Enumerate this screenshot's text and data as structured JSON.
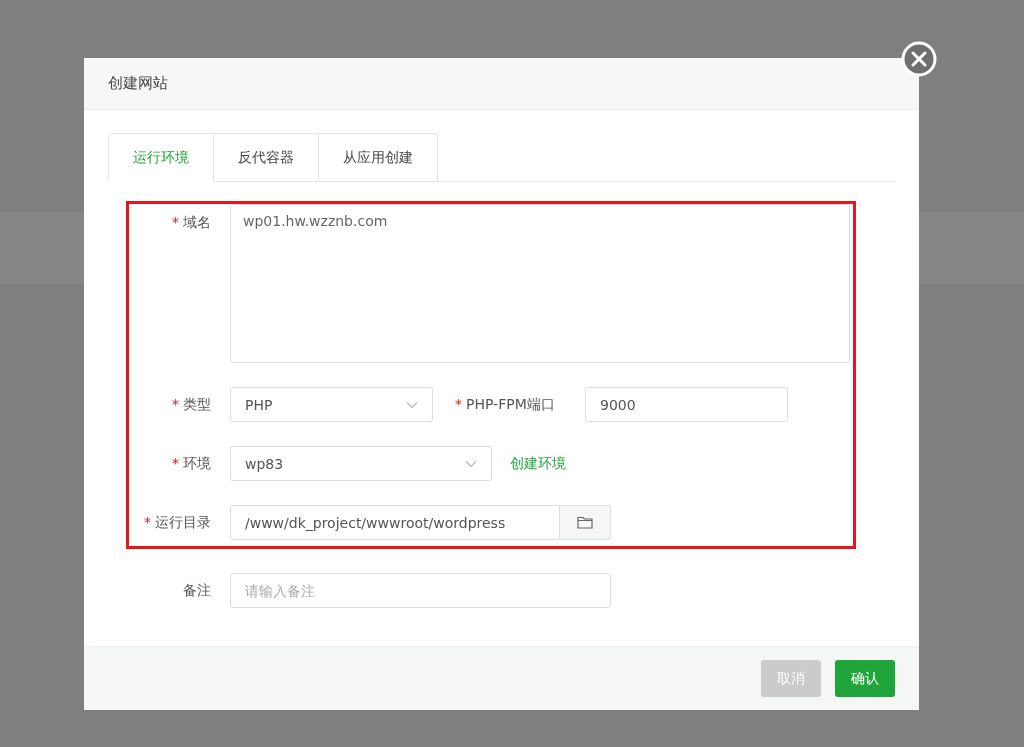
{
  "dialog": {
    "title": "创建网站"
  },
  "tabs": [
    {
      "label": "运行环境",
      "selected": true
    },
    {
      "label": "反代容器",
      "selected": false
    },
    {
      "label": "从应用创建",
      "selected": false
    }
  ],
  "domain": {
    "mark": "*",
    "label": "域名",
    "value": "wp01.hw.wzznb.com"
  },
  "type": {
    "mark": "*",
    "label": "类型",
    "value": "PHP"
  },
  "fpm_port": {
    "mark": "*",
    "label": "PHP-FPM端口",
    "value": "9000"
  },
  "environment": {
    "mark": "*",
    "label": "环境",
    "value": "wp83",
    "link": "创建环境"
  },
  "run_dir": {
    "mark": "*",
    "label": "运行目录",
    "value": "/www/dk_project/wwwroot/wordpress"
  },
  "remark": {
    "label": "备注",
    "placeholder": "请输入备注"
  },
  "buttons": [
    {
      "label": "取消",
      "kind": "cancel"
    },
    {
      "label": "确认",
      "kind": "primary"
    }
  ]
}
